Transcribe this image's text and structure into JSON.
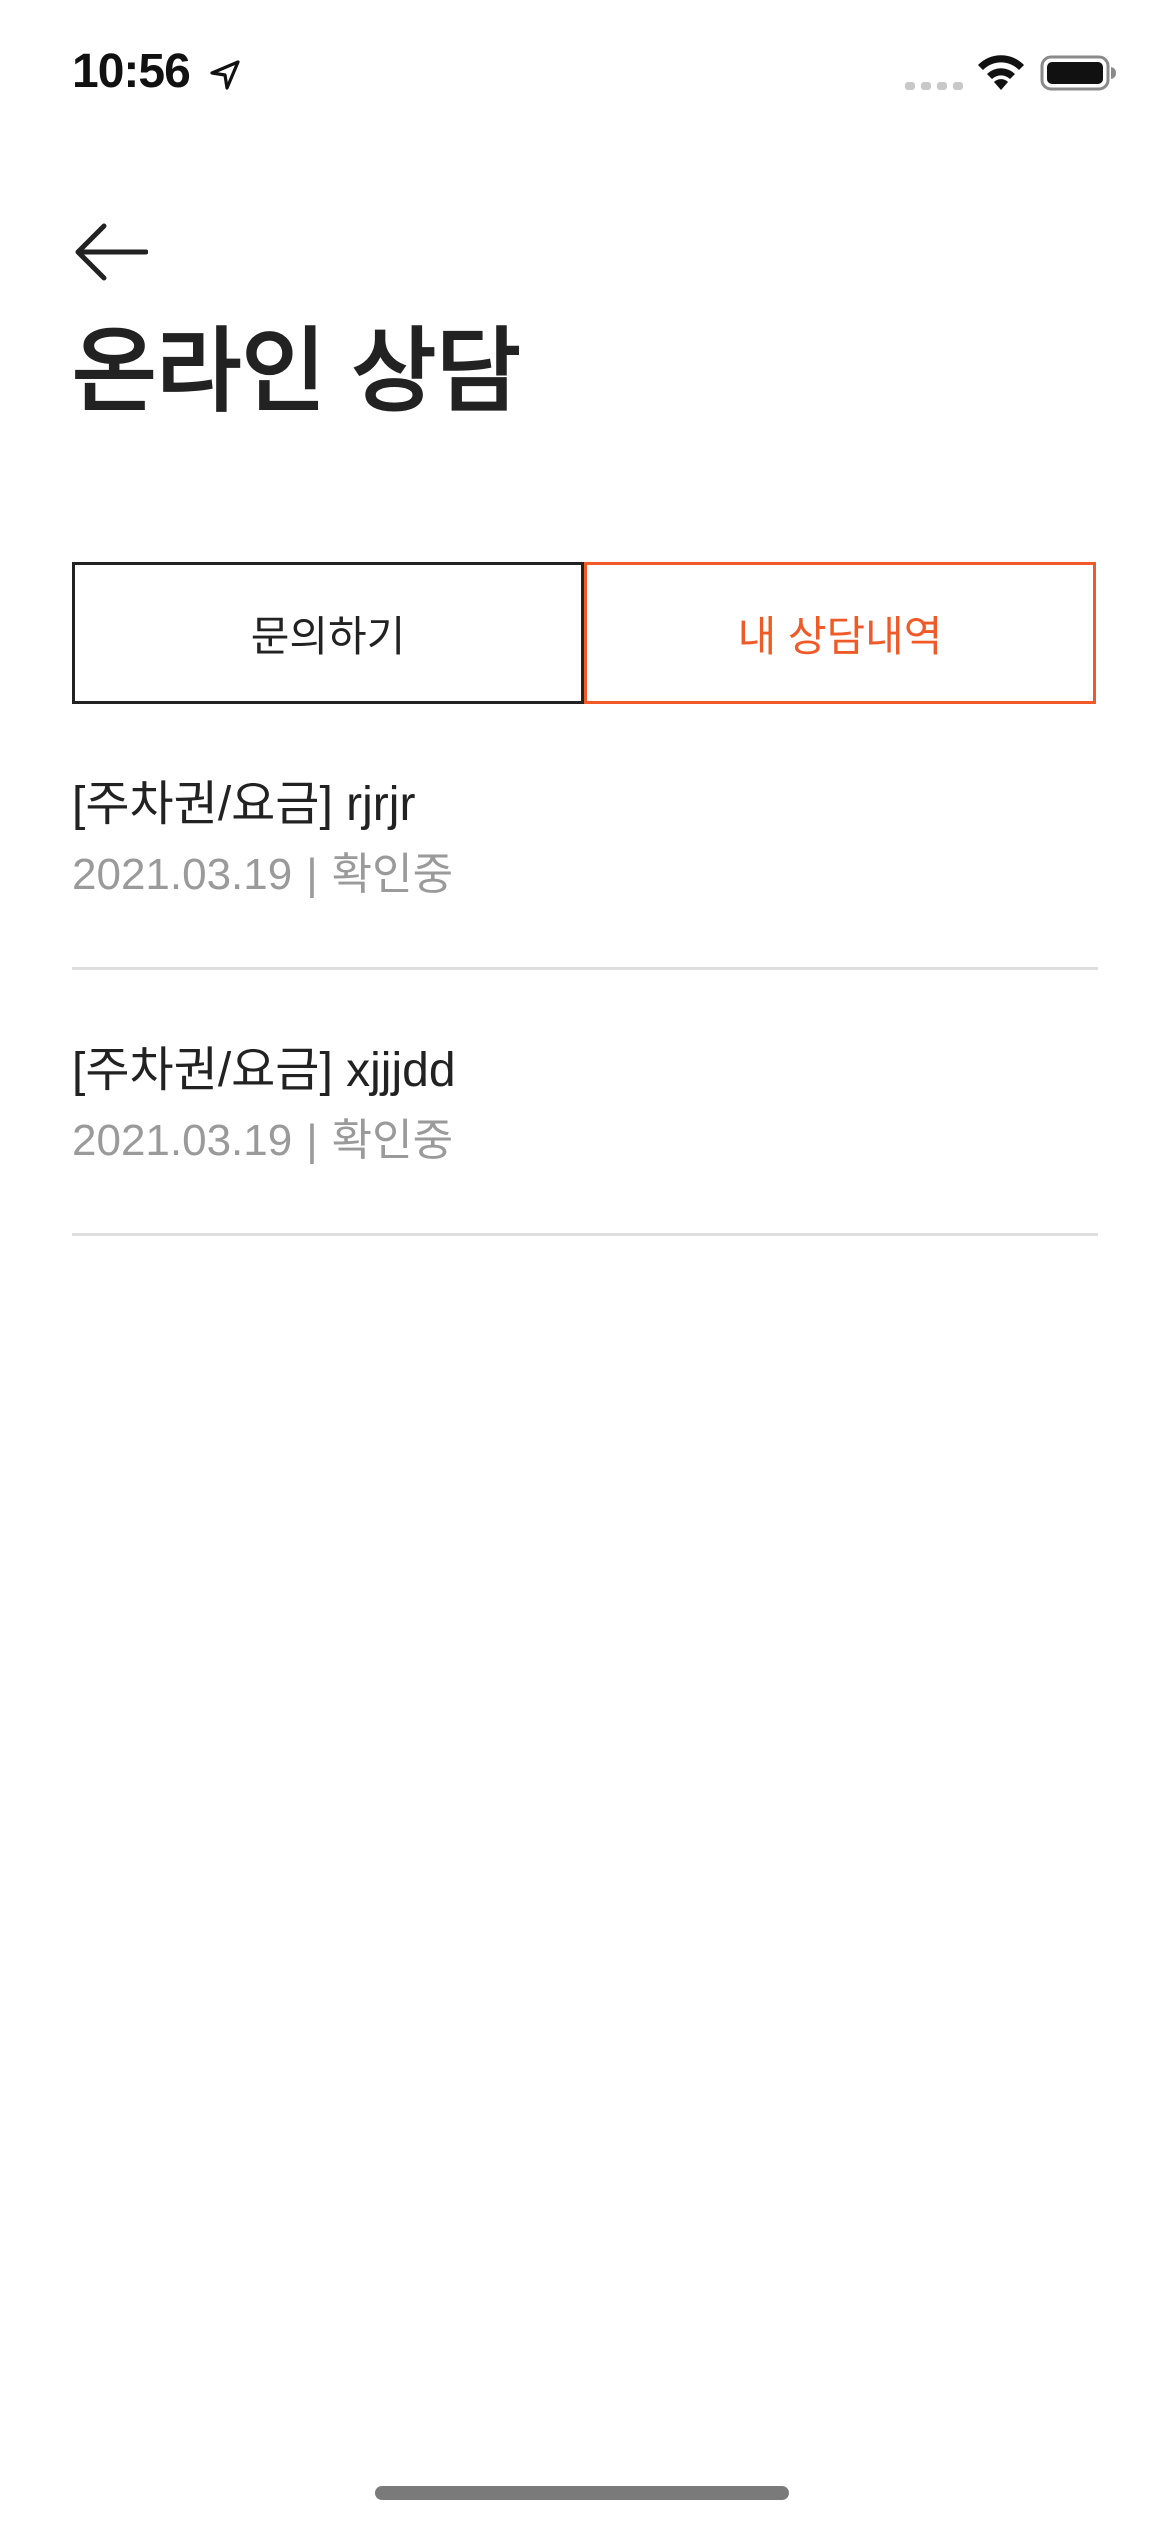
{
  "status_bar": {
    "time": "10:56",
    "location_icon": "location-arrow-icon",
    "signal_icon": "cellular-signal-icon",
    "wifi_icon": "wifi-icon",
    "battery_icon": "battery-full-icon"
  },
  "header": {
    "back_icon": "arrow-left-icon",
    "title": "온라인 상담"
  },
  "tabs": [
    {
      "label": "문의하기",
      "active": false
    },
    {
      "label": "내 상담내역",
      "active": true
    }
  ],
  "inquiries": [
    {
      "title": "[주차권/요금] rjrjr",
      "date": "2021.03.19",
      "separator": "|",
      "status": "확인중"
    },
    {
      "title": "[주차권/요금] xjjjdd",
      "date": "2021.03.19",
      "separator": "|",
      "status": "확인중"
    }
  ],
  "colors": {
    "accent": "#f05a28",
    "text_primary": "#222222",
    "text_secondary": "#9a9a9a",
    "divider": "#dedede"
  }
}
